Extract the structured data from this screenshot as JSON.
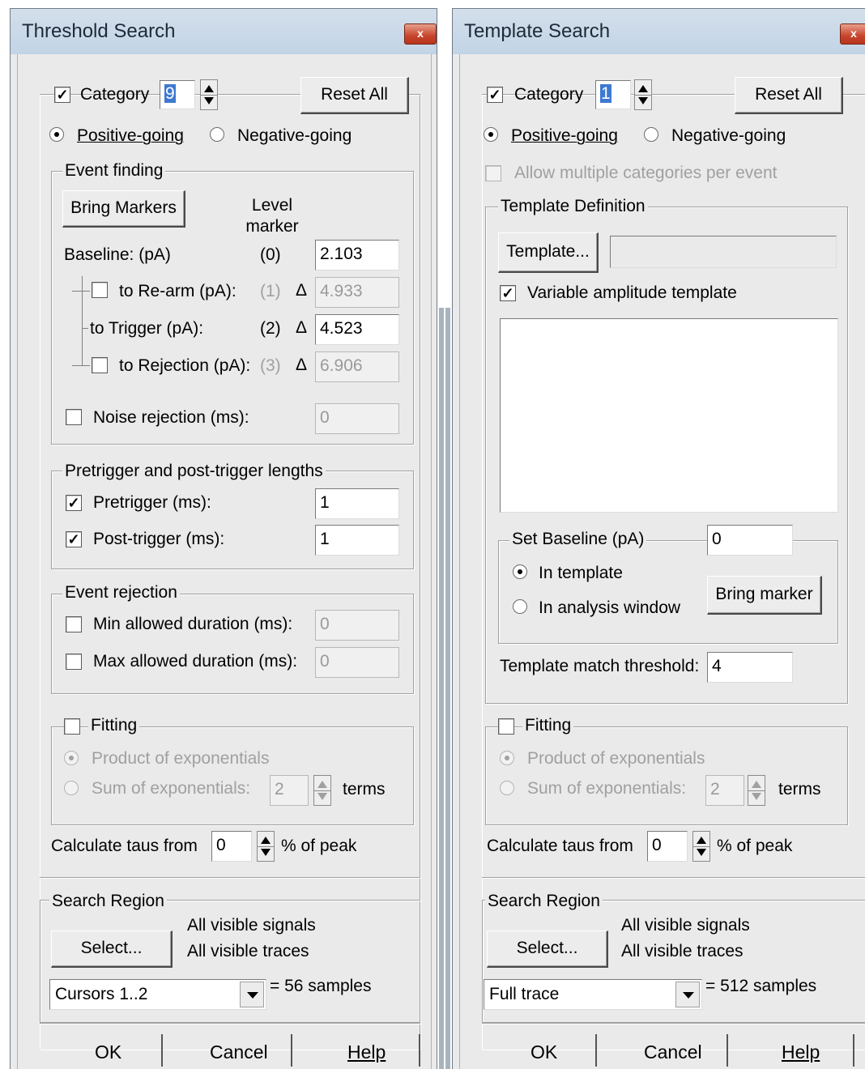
{
  "threshold": {
    "title": "Threshold Search",
    "close_label": "x",
    "category_label": "Category",
    "category_value": "9",
    "reset_label": "Reset All",
    "positive_label": "Positive-going",
    "negative_label": "Negative-going",
    "event_finding": {
      "legend": "Event finding",
      "bring_markers_label": "Bring Markers",
      "level_marker_label": "Level marker",
      "baseline": {
        "label": "Baseline: (pA)",
        "marker": "(0)",
        "value": "2.103"
      },
      "rearm": {
        "label": "to Re-arm (pA):",
        "marker": "(1)",
        "delta": "Δ",
        "value": "4.933"
      },
      "trigger": {
        "label": "to Trigger (pA):",
        "marker": "(2)",
        "delta": "Δ",
        "value": "4.523"
      },
      "rejection": {
        "label": "to Rejection (pA):",
        "marker": "(3)",
        "delta": "Δ",
        "value": "6.906"
      },
      "noise": {
        "label": "Noise rejection (ms):",
        "value": "0"
      }
    },
    "lengths": {
      "legend": "Pretrigger and post-trigger lengths",
      "pretrigger": {
        "label": "Pretrigger (ms):",
        "value": "1"
      },
      "posttrigger": {
        "label": "Post-trigger (ms):",
        "value": "1"
      }
    },
    "rejection": {
      "legend": "Event rejection",
      "min": {
        "label": "Min allowed duration (ms):",
        "value": "0"
      },
      "max": {
        "label": "Max allowed duration (ms):",
        "value": "0"
      }
    },
    "fitting": {
      "label": "Fitting",
      "product_label": "Product of exponentials",
      "sum_label": "Sum of exponentials:",
      "terms_value": "2",
      "terms_label": "terms"
    },
    "taus": {
      "label": "Calculate taus from",
      "value": "0",
      "suffix": "% of peak"
    },
    "search_region": {
      "legend": "Search Region",
      "select_label": "Select...",
      "line1": "All visible signals",
      "line2": "All visible traces",
      "combo_value": "Cursors 1..2",
      "samples": "= 56 samples"
    },
    "ok_label": "OK",
    "cancel_label": "Cancel",
    "help_label": "Help"
  },
  "template": {
    "title": "Template Search",
    "close_label": "x",
    "category_label": "Category",
    "category_value": "1",
    "reset_label": "Reset All",
    "positive_label": "Positive-going",
    "negative_label": "Negative-going",
    "allow_multiple_label": "Allow multiple categories per event",
    "definition": {
      "legend": "Template Definition",
      "template_button_label": "Template...",
      "template_name_value": "",
      "variable_amplitude_label": "Variable amplitude template"
    },
    "baseline": {
      "legend": "Set Baseline (pA)",
      "value": "0",
      "in_template_label": "In template",
      "in_window_label": "In analysis window",
      "bring_marker_label": "Bring marker"
    },
    "threshold": {
      "label": "Template match threshold:",
      "value": "4"
    },
    "fitting": {
      "label": "Fitting",
      "product_label": "Product of exponentials",
      "sum_label": "Sum of exponentials:",
      "terms_value": "2",
      "terms_label": "terms"
    },
    "taus": {
      "label": "Calculate taus from",
      "value": "0",
      "suffix": "% of peak"
    },
    "search_region": {
      "legend": "Search Region",
      "select_label": "Select...",
      "line1": "All visible signals",
      "line2": "All visible traces",
      "combo_value": "Full trace",
      "samples": "= 512 samples"
    },
    "ok_label": "OK",
    "cancel_label": "Cancel",
    "help_label": "Help"
  }
}
